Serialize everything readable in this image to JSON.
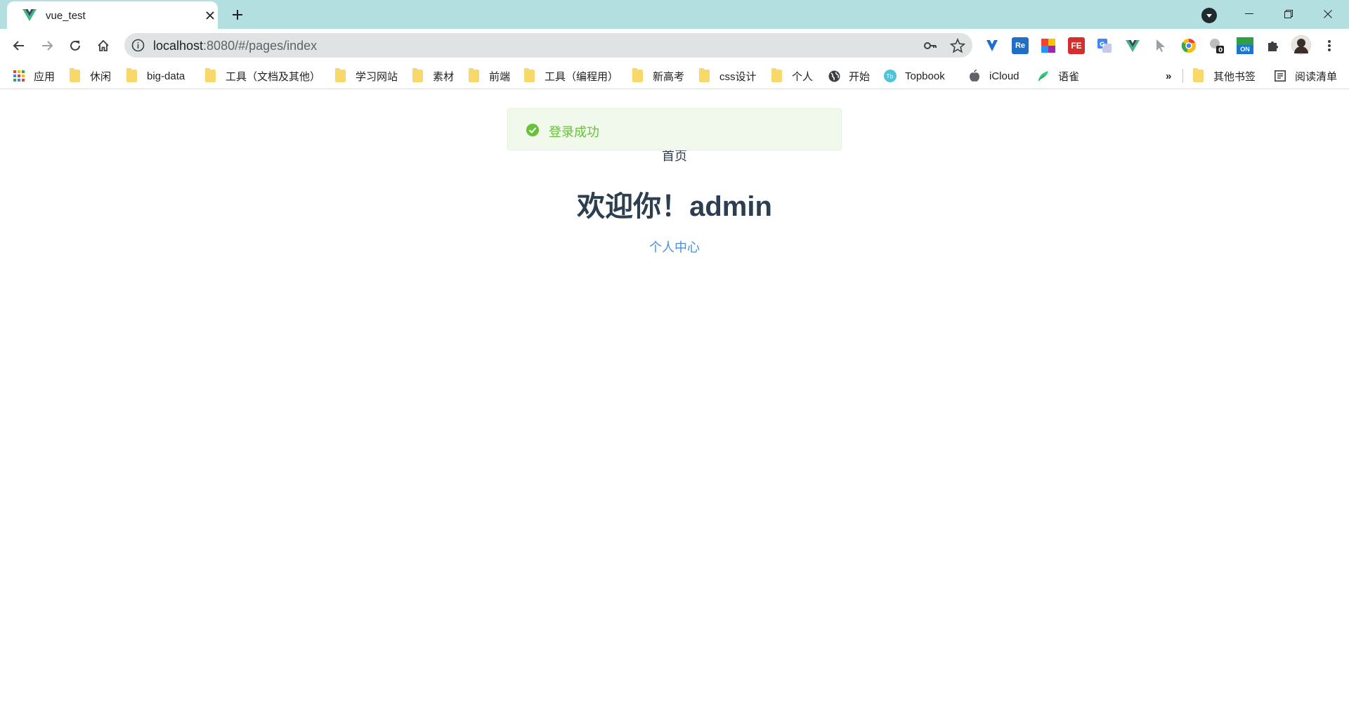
{
  "browser": {
    "tab": {
      "title": "vue_test"
    },
    "address_bar": {
      "host": "localhost",
      "rest": ":8080/#/pages/index"
    },
    "bookmarks": [
      {
        "label": "应用",
        "icon": "apps-grid-icon"
      },
      {
        "label": "休闲",
        "icon": "folder-icon"
      },
      {
        "label": "big-data",
        "icon": "folder-icon"
      },
      {
        "label": "工具（文档及其他）",
        "icon": "folder-icon"
      },
      {
        "label": "学习网站",
        "icon": "folder-icon"
      },
      {
        "label": "素材",
        "icon": "folder-icon"
      },
      {
        "label": "前端",
        "icon": "folder-icon"
      },
      {
        "label": "工具（编程用）",
        "icon": "folder-icon"
      },
      {
        "label": "新高考",
        "icon": "folder-icon"
      },
      {
        "label": "css设计",
        "icon": "folder-icon"
      },
      {
        "label": "个人",
        "icon": "folder-icon"
      },
      {
        "label": "开始",
        "icon": "globe-icon"
      },
      {
        "label": "Topbook",
        "icon": "topbook-icon"
      },
      {
        "label": "iCloud",
        "icon": "apple-icon"
      },
      {
        "label": "语雀",
        "icon": "yuque-icon"
      }
    ],
    "overflow_label": "»",
    "other_bookmarks": "其他书签",
    "reading_list": "阅读清单",
    "colors": {
      "tabstrip": "#b4dfe0",
      "omnibox": "#dfe3e4"
    }
  },
  "page": {
    "toast": {
      "message": "登录成功",
      "color": "#67c23a"
    },
    "heading": "首页",
    "welcome": "欢迎你！admin",
    "profile_link": "个人中心"
  }
}
